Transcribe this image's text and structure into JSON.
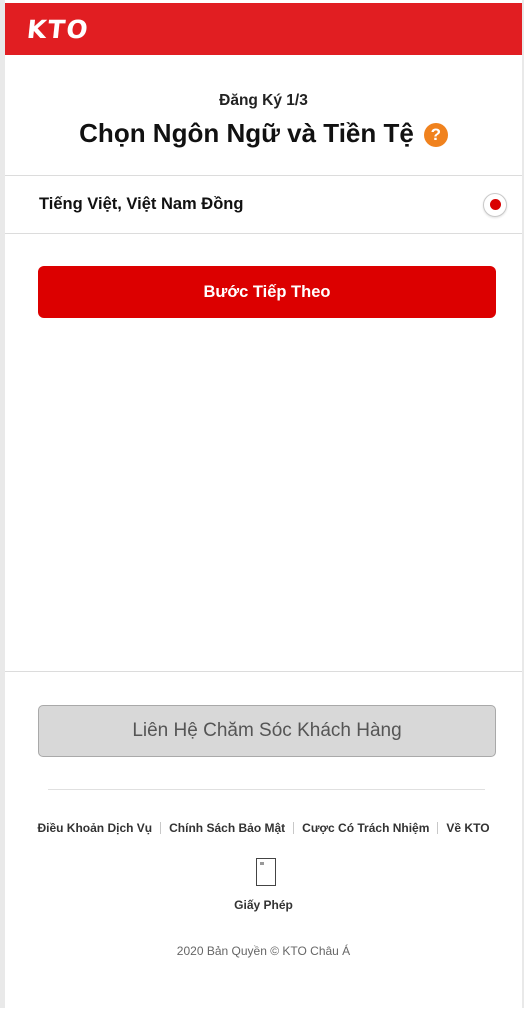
{
  "header": {
    "logo_text": "KTO",
    "background_color": "#e11e22"
  },
  "registration": {
    "step": "Đăng Ký 1/3",
    "title": "Chọn Ngôn Ngữ và Tiền Tệ",
    "help_icon": "question-circle-icon",
    "help_icon_glyph": "?",
    "help_icon_color": "#f0821e"
  },
  "options": [
    {
      "label": "Tiếng Việt, Việt Nam Đồng",
      "selected": true
    }
  ],
  "next_button": {
    "label": "Bước Tiếp Theo",
    "color": "#dc0000"
  },
  "contact_button": {
    "label": "Liên Hệ Chăm Sóc Khách Hàng"
  },
  "footer": {
    "links": [
      "Điều Khoản Dịch Vụ",
      "Chính Sách Bảo Mật",
      "Cược Có Trách Nhiệm",
      "Về KTO"
    ],
    "license_icon": "document-icon",
    "license_label": "Giấy Phép",
    "copyright": "2020 Bản Quyền © KTO Châu Á"
  }
}
